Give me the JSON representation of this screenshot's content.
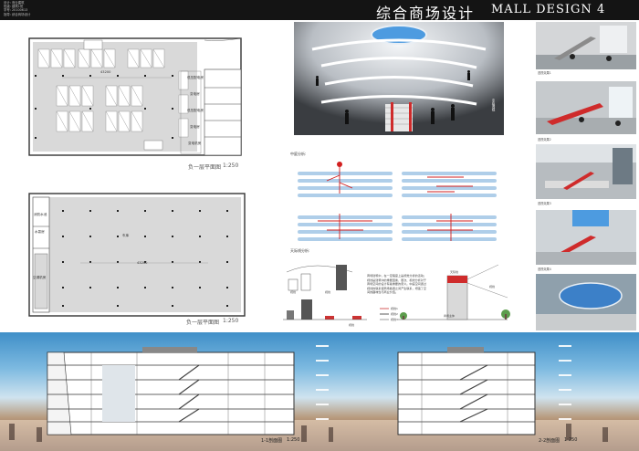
{
  "header": {
    "title_cn": "综合商场设计",
    "title_en": "MALL DESIGN 4",
    "info_lines": [
      "设计: 商业建筑",
      "班级: 建筑1班",
      "学号: 20100613",
      "指导: 综合商场设计"
    ]
  },
  "plan_b1": {
    "title": "负一层平面图",
    "scale": "1:250",
    "dimension": "43200",
    "rooms": [
      "低压配电房",
      "变电房",
      "低压配电房",
      "变电房",
      "变电机房"
    ]
  },
  "plan_b2": {
    "title": "负一层平面图",
    "scale": "1:250",
    "dimension": "43200",
    "rooms": [
      "消防水池",
      "水泵房",
      "空调机房",
      "车库"
    ]
  },
  "render": {
    "caption": "中庭透视"
  },
  "analysis": {
    "atrium_label": "中庭分析:",
    "sight_label": "天际线分析:",
    "paragraph": "商场建筑中，在一定程度上是视觉分析的活动；视线是建筑中的重要因素，层次、视线分析对于商场空间的设计有着重要的意义。中庭空间通过视线的联系使商场各层之间产生联系，增强了空间的趣味性与商业价值。",
    "legend": [
      "视线1",
      "视线2",
      "视线3"
    ],
    "bar_labels": [
      "天际线",
      "商场主体"
    ],
    "sub_labels": [
      "视线",
      "视线",
      "视线",
      "视线"
    ]
  },
  "thumbs": [
    "透视效果1",
    "透视效果2",
    "透视效果3",
    "透视效果4",
    "入口透视效果"
  ],
  "sections": {
    "left_title": "1-1剖面图",
    "left_scale": "1:250",
    "right_title": "2-2剖面图",
    "right_scale": "1:250"
  },
  "colors": {
    "header": "#141414",
    "plan_fill": "#d9d9d9",
    "accent_red": "#d21f1f",
    "sky": "#7cb9e0"
  }
}
